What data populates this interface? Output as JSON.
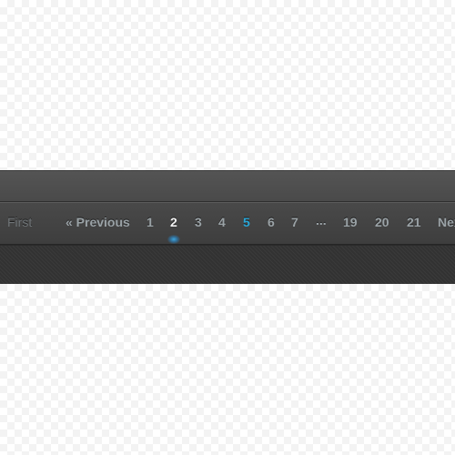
{
  "pagination": {
    "first_label": "First",
    "previous_label": "« Previous",
    "pages": [
      "1",
      "2",
      "3",
      "4",
      "5",
      "6",
      "7",
      "...",
      "19",
      "20",
      "21"
    ],
    "current_page": "2",
    "highlighted_page": "5",
    "next_label": "Next"
  },
  "colors": {
    "accent": "#2aa6d6",
    "current_page_text": "#f2f2f2",
    "link_text": "#9aa2a6",
    "disabled_text": "#707578",
    "bar_background": "#454545"
  }
}
